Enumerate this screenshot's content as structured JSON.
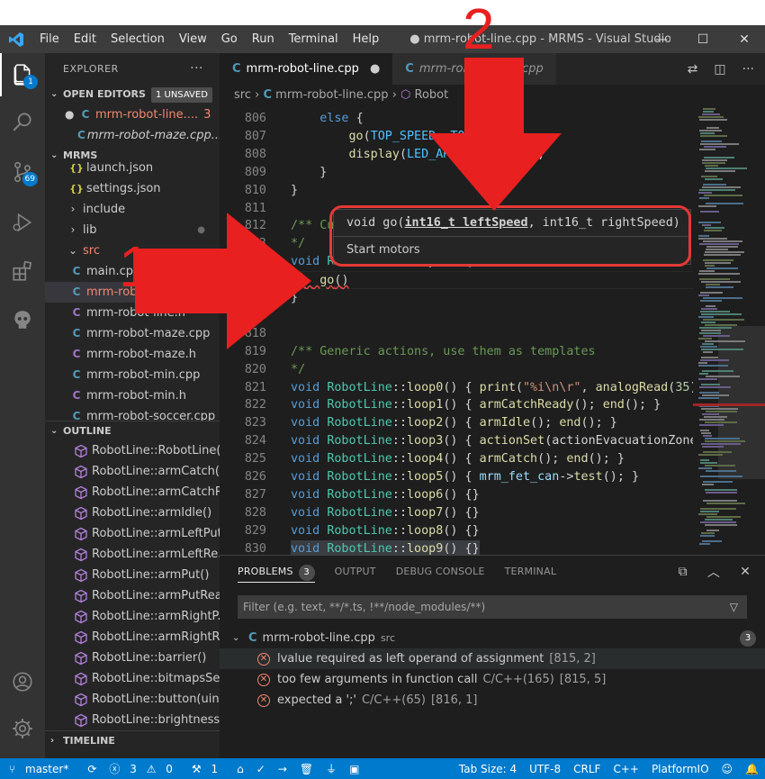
{
  "window": {
    "title": "● mrm-robot-line.cpp - MRMS - Visual Studio ...",
    "menu": [
      "File",
      "Edit",
      "Selection",
      "View",
      "Go",
      "Run",
      "Terminal",
      "Help"
    ]
  },
  "activity": {
    "explorer_badge": "1",
    "scm_badge": "69"
  },
  "sidebar": {
    "title": "EXPLORER",
    "more": "···",
    "open_editors": {
      "header": "OPEN EDITORS",
      "unsaved": "1 UNSAVED",
      "items": [
        {
          "icon": "C",
          "name": "mrm-robot-line....",
          "count": "3"
        },
        {
          "icon": "C",
          "name": "mrm-robot-maze.cpp..."
        }
      ]
    },
    "workspace": {
      "header": "MRMS",
      "items": [
        {
          "icon": "{}",
          "name": "launch.json"
        },
        {
          "icon": "{}",
          "name": "settings.json"
        },
        {
          "icon": "›",
          "name": "include"
        },
        {
          "icon": "›",
          "name": "lib"
        },
        {
          "icon": "⌄",
          "name": "src"
        },
        {
          "icon": "C",
          "name": "main.cpp"
        },
        {
          "icon": "C",
          "name": "mrm-robot-line.cpp"
        },
        {
          "icon": "C",
          "name": "mrm-robot-line.h"
        },
        {
          "icon": "C",
          "name": "mrm-robot-maze.cpp"
        },
        {
          "icon": "C",
          "name": "mrm-robot-maze.h"
        },
        {
          "icon": "C",
          "name": "mrm-robot-min.cpp"
        },
        {
          "icon": "C",
          "name": "mrm-robot-min.h"
        },
        {
          "icon": "C",
          "name": "mrm-robot-soccer.cpp"
        }
      ]
    },
    "outline": {
      "header": "OUTLINE",
      "items": [
        "RobotLine::RobotLine(...",
        "RobotLine::armCatch()",
        "RobotLine::armCatchR...",
        "RobotLine::armIdle()",
        "RobotLine::armLeftPut()",
        "RobotLine::armLeftRe...",
        "RobotLine::armPut()",
        "RobotLine::armPutRea...",
        "RobotLine::armRightP...",
        "RobotLine::armRightR...",
        "RobotLine::barrier()",
        "RobotLine::bitmapsSet()",
        "RobotLine::button(uin...",
        "RobotLine::brightness..."
      ]
    },
    "timeline": "TIMELINE"
  },
  "editor": {
    "tabs": [
      {
        "label": "mrm-robot-line.cpp",
        "close": "●"
      },
      {
        "label": "mrm-robot-maze.cpp"
      }
    ],
    "breadcrumb": {
      "folder": "src",
      "file": "mrm-robot-line.cpp",
      "symbol": "Robot"
    },
    "lines": [
      {
        "n": "806",
        "code": "    else {"
      },
      {
        "n": "807",
        "code": "        go(TOP_SPEED, TOP_SPEED);"
      },
      {
        "n": "808",
        "code": "        display(LED_ARROW_FORWARD);"
      },
      {
        "n": "809",
        "code": "    }"
      },
      {
        "n": "810",
        "code": "}"
      },
      {
        "n": "811",
        "code": ""
      },
      {
        "n": "812",
        "code": "/** Custom test"
      },
      {
        "n": "813",
        "code": "*/"
      },
      {
        "n": "814",
        "code": "void RobotLine::loop9() {"
      },
      {
        "n": "815",
        "code": "    go()"
      },
      {
        "n": "816",
        "code": "}"
      },
      {
        "n": "817",
        "code": ""
      },
      {
        "n": "818",
        "code": ""
      },
      {
        "n": "819",
        "code": "/** Generic actions, use them as templates"
      },
      {
        "n": "820",
        "code": "*/"
      },
      {
        "n": "821",
        "code": "void RobotLine::loop0() { print(\"%i\\n\\r\", analogRead(35)"
      },
      {
        "n": "822",
        "code": "void RobotLine::loop1() { armCatchReady(); end(); }"
      },
      {
        "n": "823",
        "code": "void RobotLine::loop2() { armIdle(); end(); }"
      },
      {
        "n": "824",
        "code": "void RobotLine::loop3() { actionSet(actionEvacuationZone"
      },
      {
        "n": "825",
        "code": "void RobotLine::loop4() { armCatch(); end(); }"
      },
      {
        "n": "826",
        "code": "void RobotLine::loop5() { mrm_fet_can->test(); }"
      },
      {
        "n": "827",
        "code": "void RobotLine::loop6() {}"
      },
      {
        "n": "828",
        "code": "void RobotLine::loop7() {}"
      },
      {
        "n": "829",
        "code": "void RobotLine::loop8() {}"
      },
      {
        "n": "830",
        "code": "void RobotLine::loop9() {}"
      }
    ],
    "hover": {
      "sig_prefix": "void go(",
      "sig_active": "int16_t leftSpeed",
      "sig_suffix": ", int16_t rightSpeed)",
      "doc": "Start motors"
    }
  },
  "panel": {
    "tabs": [
      "PROBLEMS",
      "OUTPUT",
      "DEBUG CONSOLE",
      "TERMINAL"
    ],
    "problems_count": "3",
    "filter_placeholder": "Filter (e.g. text, **/*.ts, !**/node_modules/**)",
    "file": {
      "name": "mrm-robot-line.cpp",
      "folder": "src",
      "count": "3"
    },
    "problems": [
      {
        "msg": "lvalue required as left operand of assignment",
        "source": "",
        "loc": "[815, 2]"
      },
      {
        "msg": "too few arguments in function call",
        "source": "C/C++(165)",
        "loc": "[815, 5]"
      },
      {
        "msg": "expected a ';'",
        "source": "C/C++(65)",
        "loc": "[816, 1]"
      }
    ]
  },
  "status": {
    "branch": "master*",
    "errors": "3",
    "warnings": "0",
    "ports": "1",
    "tab_size": "Tab Size: 4",
    "encoding": "UTF-8",
    "eol": "CRLF",
    "language": "C++",
    "platform": "PlatformIO"
  },
  "annotations": {
    "one": "1",
    "two": "2"
  },
  "colors": {
    "accent": "#007acc",
    "annotation": "#e82020",
    "error": "#f48771"
  }
}
